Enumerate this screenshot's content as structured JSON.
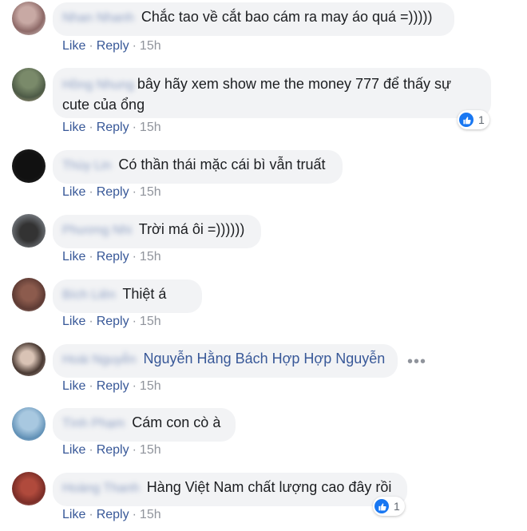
{
  "actions": {
    "like": "Like",
    "reply": "Reply",
    "separator": "·"
  },
  "comments": [
    {
      "name": "Nhan Nhanh",
      "tag": "",
      "text": "Chắc tao về cắt bao cám ra may áo quá =)))))",
      "time": "15h",
      "reactions": null
    },
    {
      "name": "Hồng Nhung",
      "tag": "",
      "text_line1": "bây hãy xem show me the money 777 để thấy sự",
      "text_line2": "cute của ổng",
      "time": "15h",
      "reactions": "1"
    },
    {
      "name": "Thùy Lin",
      "tag": "",
      "text": "Có thần thái mặc cái bì vẫn truất",
      "time": "15h",
      "reactions": null
    },
    {
      "name": "Phương Nhi",
      "tag": "",
      "text": "Trời má ôi =))))))",
      "time": "15h",
      "reactions": null
    },
    {
      "name": "Bích Liên",
      "tag": "",
      "text": "Thiệt á",
      "time": "15h",
      "reactions": null
    },
    {
      "name": "Hoài Nguyễn",
      "tag": "Nguyễn Hằng Bách Hợp Hợp Nguyễn",
      "text": "",
      "time": "15h",
      "reactions": null
    },
    {
      "name": "Tình Phạm",
      "tag": "",
      "text": "Cám con cò à",
      "time": "15h",
      "reactions": null
    },
    {
      "name": "Hoàng Thanh",
      "tag": "",
      "text": "Hàng Việt Nam chất lượng cao đây rồi",
      "time": "15h",
      "reactions": "1"
    }
  ],
  "colors": {
    "link": "#385898",
    "bubble": "#f2f3f5",
    "like_blue": "#1877f2"
  }
}
